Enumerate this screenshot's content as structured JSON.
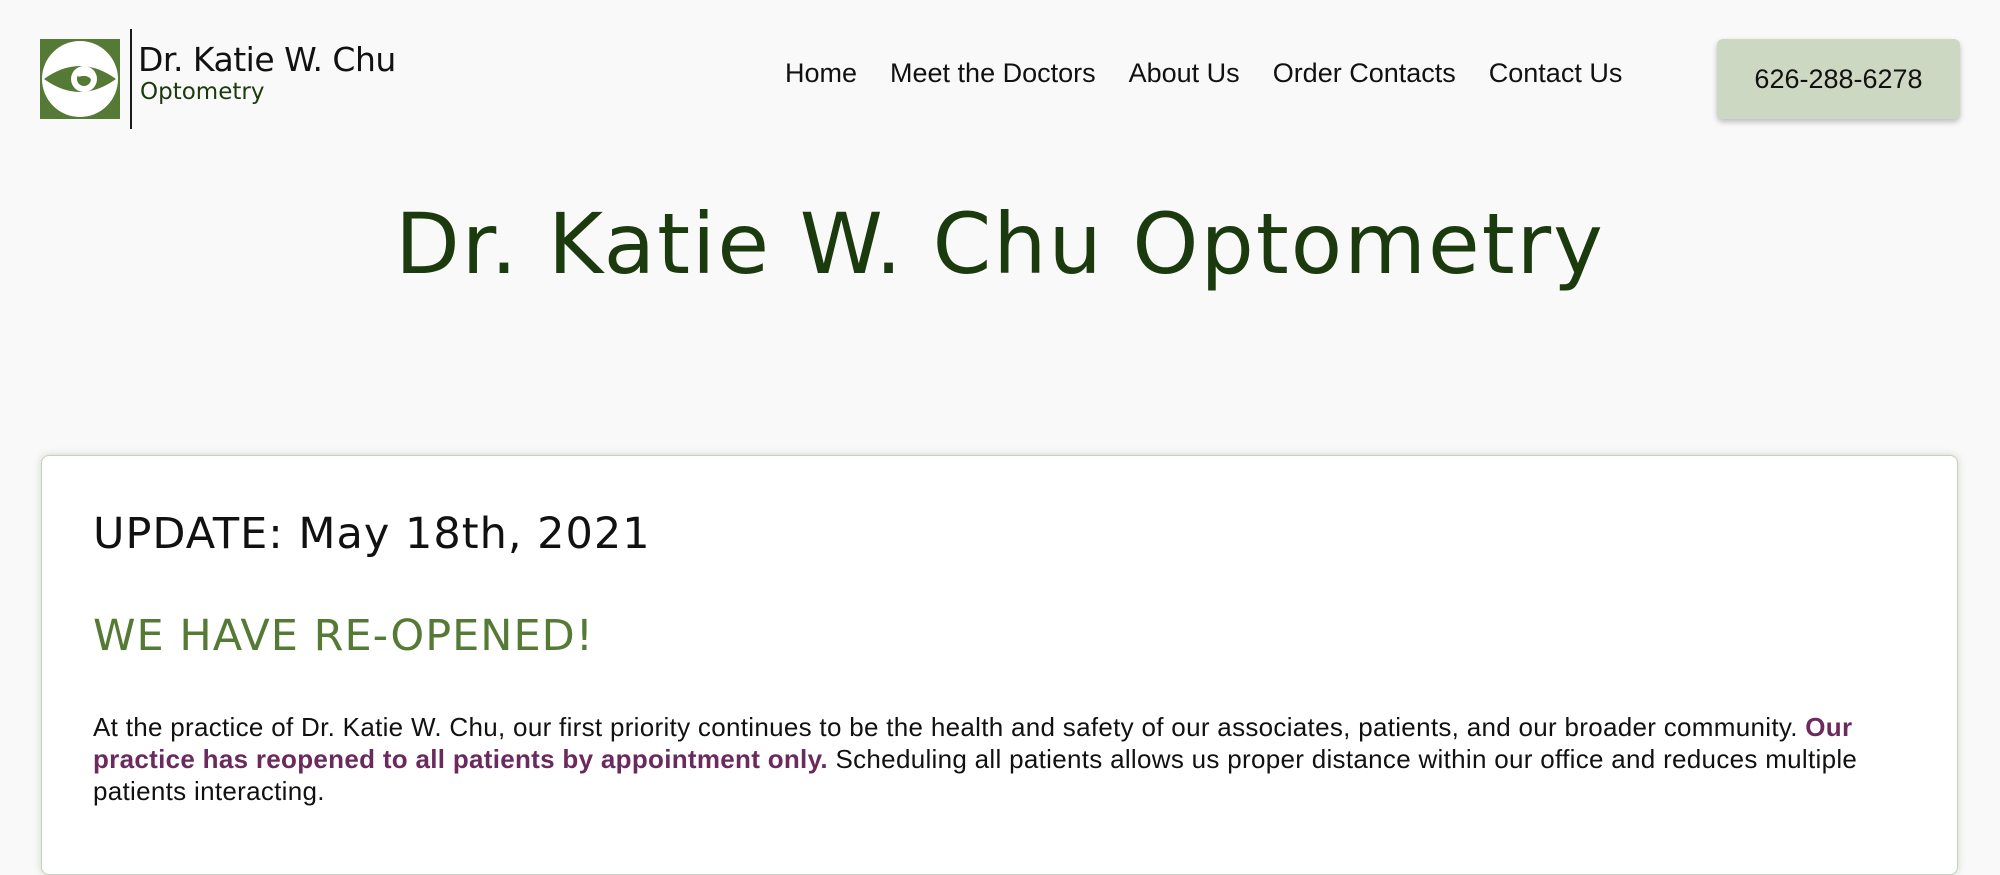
{
  "header": {
    "logo": {
      "icon": "eye-icon",
      "name": "Dr. Katie W. Chu",
      "subtitle": "Optometry"
    },
    "nav": [
      {
        "label": "Home"
      },
      {
        "label": "Meet the Doctors"
      },
      {
        "label": "About Us"
      },
      {
        "label": "Order Contacts"
      },
      {
        "label": "Contact Us"
      }
    ],
    "phone_button": "626-288-6278"
  },
  "hero": {
    "title": "Dr. Katie W. Chu Optometry"
  },
  "notice": {
    "update_heading": "UPDATE: May 18th, 2021",
    "reopen_heading": "WE HAVE RE-OPENED!",
    "body_before": "At the practice of Dr. Katie W. Chu, our first priority continues to be the health and safety of our associates, patients, and our broader community. ",
    "body_highlight": "Our practice has reopened to all patients by appointment only.",
    "body_after": " Scheduling all patients allows us proper distance within our office and reduces multiple patients interacting."
  },
  "colors": {
    "brand_green": "#557a35",
    "dark_green": "#1b3a0e",
    "button_bg": "#cdd8c3",
    "highlight_purple": "#6b2a5e",
    "page_bg": "#f9f9f9"
  }
}
